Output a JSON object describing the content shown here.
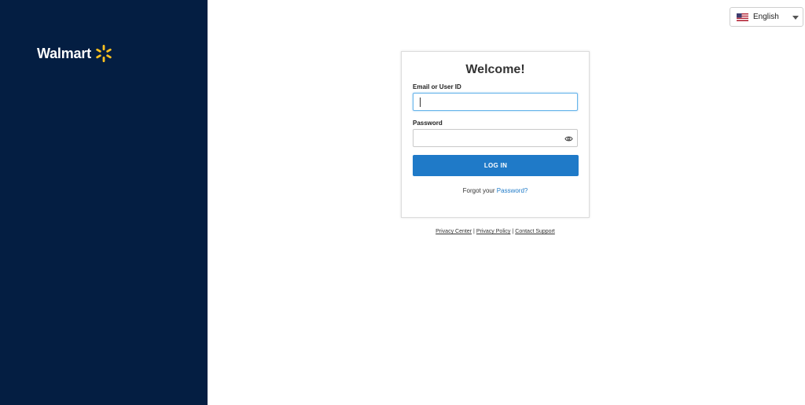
{
  "brand": {
    "name": "Walmart",
    "spark_color": "#ffc220",
    "sidebar_color": "#041e42"
  },
  "language": {
    "selected": "English",
    "flag": "us-flag-icon"
  },
  "login": {
    "title": "Welcome!",
    "email_label": "Email or User ID",
    "email_value": "",
    "password_label": "Password",
    "password_value": "",
    "submit_label": "LOG IN",
    "forgot_prefix": "Forgot your ",
    "forgot_link": "Password?",
    "button_color": "#1f7ac8"
  },
  "footer": {
    "links": [
      "Privacy Center",
      "Privacy Policy",
      "Contact Support"
    ]
  }
}
